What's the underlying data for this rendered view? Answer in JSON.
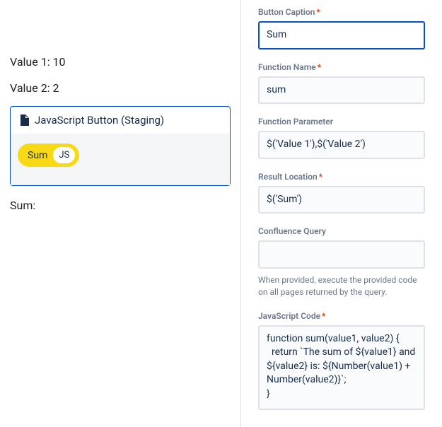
{
  "left": {
    "value1_label": "Value 1:",
    "value1": "10",
    "value2_label": "Value 2:",
    "value2": "2",
    "macro_title": "JavaScript Button (Staging)",
    "pill_label": "Sum",
    "pill_badge": "JS",
    "sum_label": "Sum:"
  },
  "form": {
    "caption": {
      "label": "Button Caption",
      "value": "Sum",
      "required": true
    },
    "fname": {
      "label": "Function Name",
      "value": "sum",
      "required": true
    },
    "fparam": {
      "label": "Function Parameter",
      "value": "$('Value 1'),$('Value 2')",
      "required": false
    },
    "result": {
      "label": "Result Location",
      "value": "$('Sum')",
      "required": true
    },
    "cquery": {
      "label": "Confluence Query",
      "value": "",
      "required": false,
      "help": "When provided, execute the provided code on all pages returned by the query."
    },
    "code": {
      "label": "JavaScript Code",
      "required": true,
      "value": "function sum(value1, value2) {\n  return `The sum of ${value1} and ${value2} is: ${Number(value1) + Number(value2)}`;\n}"
    }
  }
}
